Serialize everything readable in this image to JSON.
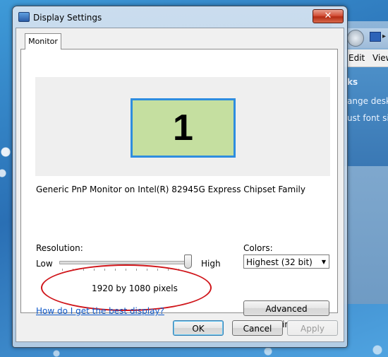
{
  "background_window": {
    "menu": {
      "edit_label": "Edit",
      "view_label": "View"
    },
    "tasks": {
      "heading": "ks",
      "item1": "ange deskt",
      "item2": "ust font siz"
    }
  },
  "dialog": {
    "title": "Display Settings",
    "close_glyph": "✕",
    "tab_label": "Monitor",
    "monitor_number": "1",
    "monitor_description": "Generic PnP Monitor on Intel(R) 82945G Express Chipset Family",
    "resolution": {
      "label": "Resolution:",
      "low_label": "Low",
      "high_label": "High",
      "value_text": "1920 by 1080 pixels",
      "slider_level": 1.0
    },
    "help_link": "How do I get the best display?",
    "colors": {
      "label": "Colors:",
      "selected": "Highest (32 bit)",
      "arrow": "▼"
    },
    "advanced_button": "Advanced Settings...",
    "buttons": {
      "ok": "OK",
      "cancel": "Cancel",
      "apply": "Apply"
    }
  },
  "colors": {
    "monitor_fill": "#c5dfa0",
    "monitor_border": "#2e8ddf",
    "link": "#0f58c8",
    "annotation_ellipse": "#d0161b"
  }
}
